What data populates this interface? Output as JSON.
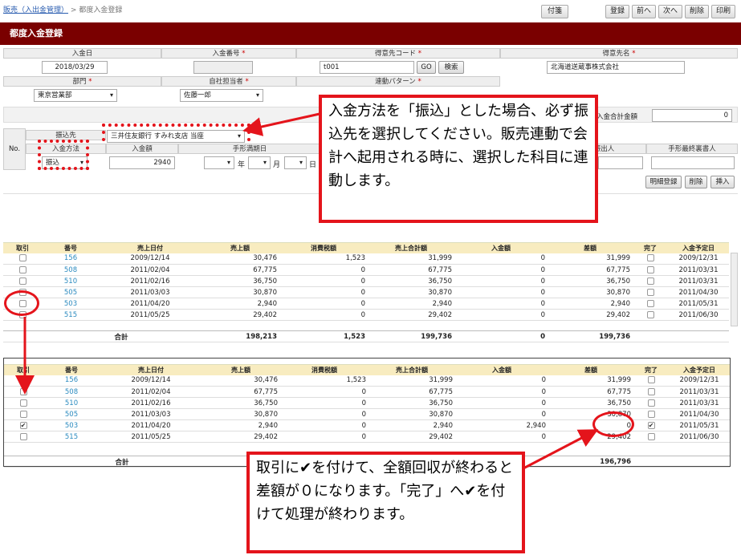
{
  "breadcrumb": {
    "link": "販売（入出金管理）",
    "sep": ">",
    "current": "都度入金登録"
  },
  "toolbar": {
    "attach": "付箋",
    "register": "登録",
    "prev": "前へ",
    "next": "次へ",
    "delete": "削除",
    "print": "印刷"
  },
  "title": "都度入金登録",
  "form": {
    "date_label": "入金日",
    "date_value": "2018/03/29",
    "no_label": "入金番号",
    "cust_code_label": "得意先コード",
    "cust_code_value": "t001",
    "go": "GO",
    "search": "検索",
    "cust_name_label": "得意先名",
    "cust_name_value": "北海道送蔵事株式会社",
    "dept_label": "部門",
    "dept_value": "東京営業部",
    "staff_label": "自社担当者",
    "staff_value": "佐藤一郎",
    "link_label": "連動パターン",
    "total_label": "入金合計金額",
    "total_value": "0"
  },
  "detail": {
    "no": "No.",
    "bank_label": "振込先",
    "bank_value": "三井住友銀行 すみれ支店 当座",
    "method_label": "入金方法",
    "method_value": "振込",
    "amount_label": "入金額",
    "amount_value": "2940",
    "due_label": "手形満期日",
    "year": "年",
    "month": "月",
    "day": "日",
    "drawer_label": "振出人",
    "endorser_label": "手形最終裏書人",
    "btn_line": "明細登録",
    "btn_del": "削除",
    "btn_ins": "挿入"
  },
  "grid_headers": [
    "取引",
    "番号",
    "売上日付",
    "売上額",
    "消費税額",
    "売上合計額",
    "入金額",
    "差額",
    "完了",
    "入金予定日"
  ],
  "grid1": {
    "rows": [
      {
        "no": "156",
        "date": "2009/12/14",
        "sales": "30,476",
        "tax": "1,523",
        "total": "31,999",
        "paid": "0",
        "diff": "31,999",
        "due": "2009/12/31",
        "chk": false,
        "done": false
      },
      {
        "no": "508",
        "date": "2011/02/04",
        "sales": "67,775",
        "tax": "0",
        "total": "67,775",
        "paid": "0",
        "diff": "67,775",
        "due": "2011/03/31",
        "chk": false,
        "done": false
      },
      {
        "no": "510",
        "date": "2011/02/16",
        "sales": "36,750",
        "tax": "0",
        "total": "36,750",
        "paid": "0",
        "diff": "36,750",
        "due": "2011/03/31",
        "chk": false,
        "done": false
      },
      {
        "no": "505",
        "date": "2011/03/03",
        "sales": "30,870",
        "tax": "0",
        "total": "30,870",
        "paid": "0",
        "diff": "30,870",
        "due": "2011/04/30",
        "chk": false,
        "done": false
      },
      {
        "no": "503",
        "date": "2011/04/20",
        "sales": "2,940",
        "tax": "0",
        "total": "2,940",
        "paid": "0",
        "diff": "2,940",
        "due": "2011/05/31",
        "chk": false,
        "done": false
      },
      {
        "no": "515",
        "date": "2011/05/25",
        "sales": "29,402",
        "tax": "0",
        "total": "29,402",
        "paid": "0",
        "diff": "29,402",
        "due": "2011/06/30",
        "chk": false,
        "done": false
      }
    ],
    "total": {
      "label": "合計",
      "sales": "198,213",
      "tax": "1,523",
      "total": "199,736",
      "paid": "0",
      "diff": "199,736"
    }
  },
  "grid2": {
    "rows": [
      {
        "no": "156",
        "date": "2009/12/14",
        "sales": "30,476",
        "tax": "1,523",
        "total": "31,999",
        "paid": "0",
        "diff": "31,999",
        "due": "2009/12/31",
        "chk": false,
        "done": false
      },
      {
        "no": "508",
        "date": "2011/02/04",
        "sales": "67,775",
        "tax": "0",
        "total": "67,775",
        "paid": "0",
        "diff": "67,775",
        "due": "2011/03/31",
        "chk": false,
        "done": false
      },
      {
        "no": "510",
        "date": "2011/02/16",
        "sales": "36,750",
        "tax": "0",
        "total": "36,750",
        "paid": "0",
        "diff": "36,750",
        "due": "2011/03/31",
        "chk": false,
        "done": false
      },
      {
        "no": "505",
        "date": "2011/03/03",
        "sales": "30,870",
        "tax": "0",
        "total": "30,870",
        "paid": "0",
        "diff": "30,870",
        "due": "2011/04/30",
        "chk": false,
        "done": false
      },
      {
        "no": "503",
        "date": "2011/04/20",
        "sales": "2,940",
        "tax": "0",
        "total": "2,940",
        "paid": "2,940",
        "diff": "0",
        "due": "2011/05/31",
        "chk": true,
        "done": true
      },
      {
        "no": "515",
        "date": "2011/05/25",
        "sales": "29,402",
        "tax": "0",
        "total": "29,402",
        "paid": "0",
        "diff": "29,402",
        "due": "2011/06/30",
        "chk": false,
        "done": false
      }
    ],
    "total": {
      "label": "合計",
      "diff": "196,796"
    }
  },
  "callout1": "入金方法を「振込」とした場合、必ず振込先を選択してください。販売連動で会計へ起用される時に、選択した科目に連動します。",
  "callout2": "取引に✔を付けて、全額回収が終わると差額が０になります。「完了」へ✔を付けて処理が終わります。",
  "colors": {
    "title_bg": "#7a0000",
    "highlight": "#e4141b",
    "grid_header": "#f8ecc0",
    "link": "#2a8abf"
  }
}
